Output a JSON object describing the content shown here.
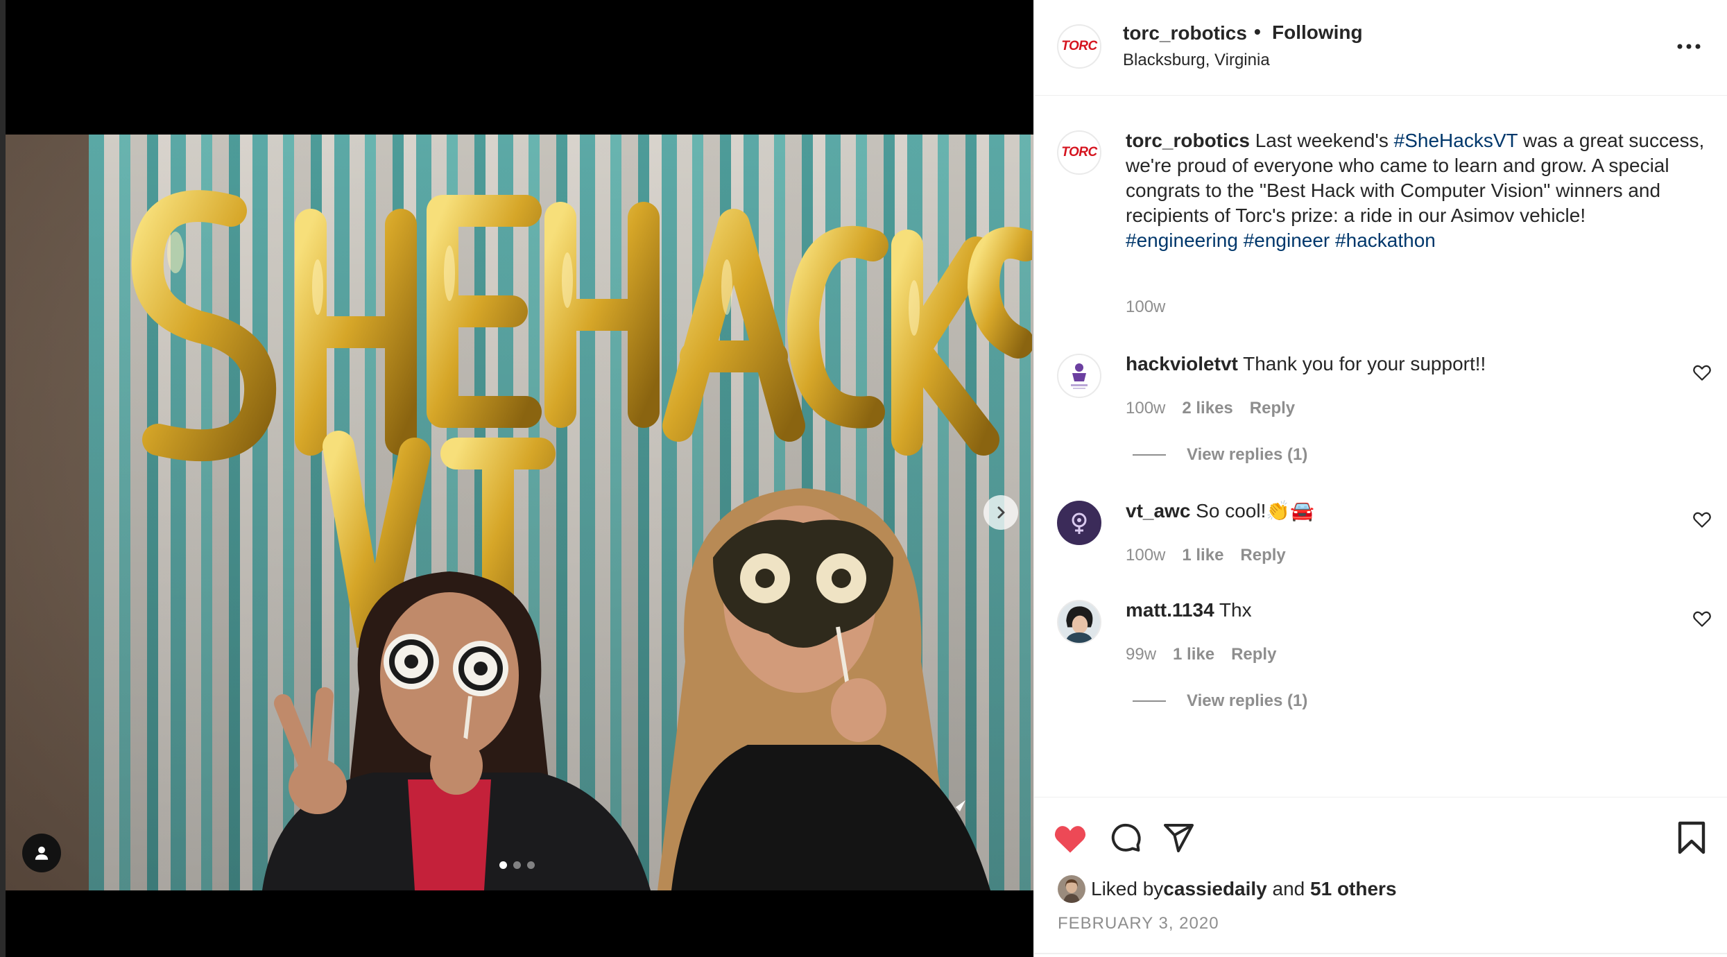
{
  "post": {
    "carousel": {
      "slide_count": 3,
      "active_index": 0
    }
  },
  "header": {
    "avatar_text": "TORC",
    "username": "torc_robotics",
    "separator": "•",
    "follow_status": "Following",
    "location": "Blacksburg, Virginia"
  },
  "caption": {
    "avatar_text": "TORC",
    "username": "torc_robotics",
    "text_1": " Last weekend's ",
    "hashtag_1": "#SheHacksVT",
    "text_2": " was a great success, we're proud of everyone who came to learn and grow. A special congrats to the \"Best Hack with Computer Vision\" winners and recipients of Torc's prize: a ride in our Asimov vehicle!",
    "hashtag_2": "#engineering",
    "hashtag_3": "#engineer",
    "hashtag_4": "#hackathon",
    "time": "100w"
  },
  "comments": [
    {
      "username": "hackvioletvt",
      "text": " Thank you for your support!!",
      "time": "100w",
      "likes": "2 likes",
      "reply": "Reply",
      "view_replies": "View replies (1)"
    },
    {
      "username": "vt_awc",
      "text": " So cool!👏🚘",
      "time": "100w",
      "likes": "1 like",
      "reply": "Reply"
    },
    {
      "username": "matt.1134",
      "text": " Thx",
      "time": "99w",
      "likes": "1 like",
      "reply": "Reply",
      "view_replies": "View replies (1)"
    }
  ],
  "likes": {
    "prefix": "Liked by ",
    "user": "cassiedaily",
    "middle": " and ",
    "others": "51 others",
    "liked": true
  },
  "date": "FEBRUARY 3, 2020",
  "colors": {
    "like_red": "#ed4956",
    "hashtag_blue": "#00376b",
    "muted_gray": "#8e8e8e",
    "torc_red": "#d5141f"
  },
  "icons": {
    "heart": "heart-icon",
    "comment": "comment-icon",
    "share": "send-icon",
    "save": "bookmark-icon",
    "more": "more-icon",
    "next": "chevron-right-icon",
    "tag": "user-tag-icon"
  }
}
